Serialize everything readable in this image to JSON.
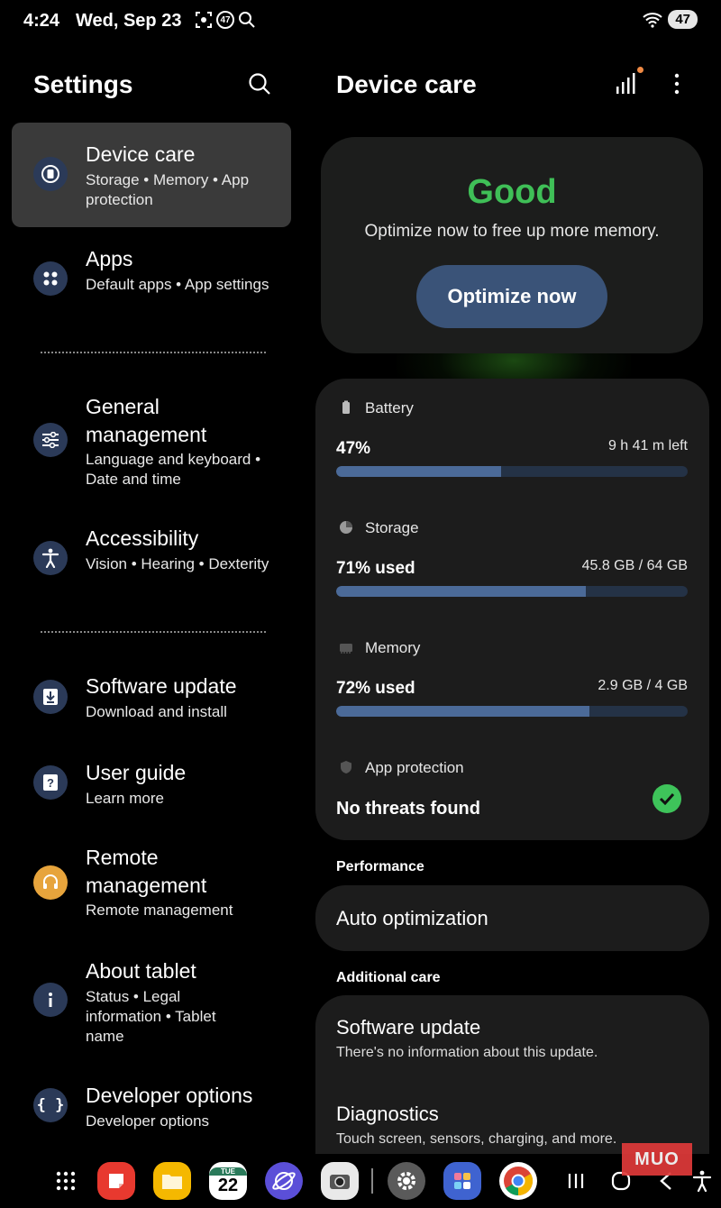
{
  "status_bar": {
    "time": "4:24",
    "date": "Wed, Sep 23",
    "notification_badge": "47",
    "battery": "47"
  },
  "left_panel": {
    "title": "Settings",
    "items": [
      {
        "title": "Device care",
        "subtitle": "Storage • Memory • App protection",
        "icon": "device-care-icon"
      },
      {
        "title": "Apps",
        "subtitle": "Default apps • App settings",
        "icon": "apps-icon"
      },
      {
        "title": "General management",
        "subtitle": "Language and keyboard • Date and time",
        "icon": "sliders-icon"
      },
      {
        "title": "Accessibility",
        "subtitle": "Vision • Hearing • Dexterity",
        "icon": "accessibility-icon"
      },
      {
        "title": "Software update",
        "subtitle": "Download and install",
        "icon": "download-icon"
      },
      {
        "title": "User guide",
        "subtitle": "Learn more",
        "icon": "help-icon"
      },
      {
        "title": "Remote management",
        "subtitle": "Remote management",
        "icon": "headset-icon"
      },
      {
        "title": "About tablet",
        "subtitle": "Status • Legal information • Tablet name",
        "icon": "info-icon"
      },
      {
        "title": "Developer options",
        "subtitle": "Developer options",
        "icon": "braces-icon"
      }
    ]
  },
  "right_panel": {
    "title": "Device care",
    "status": {
      "label": "Good",
      "description": "Optimize now to free up more memory.",
      "button": "Optimize now",
      "color": "#3fbf57"
    },
    "battery": {
      "label": "Battery",
      "value": "47%",
      "detail": "9 h 41 m left",
      "level": 0.47
    },
    "storage": {
      "label": "Storage",
      "value": "71% used",
      "detail": "45.8 GB / 64 GB",
      "level": 0.71
    },
    "memory": {
      "label": "Memory",
      "value": "72% used",
      "detail": "2.9 GB / 4 GB",
      "level": 0.72
    },
    "app_protection": {
      "label": "App protection",
      "value": "No threats found"
    },
    "performance": {
      "header": "Performance",
      "item": "Auto optimization"
    },
    "additional_care": {
      "header": "Additional care",
      "items": [
        {
          "title": "Software update",
          "subtitle": "There's no information about this update."
        },
        {
          "title": "Diagnostics",
          "subtitle": "Touch screen, sensors, charging, and more."
        }
      ]
    }
  },
  "taskbar": {
    "calendar_day": "22",
    "calendar_dow": "TUE",
    "apps": [
      "apps-grid-icon",
      "notes-app-icon",
      "files-app-icon",
      "calendar-app-icon",
      "internet-app-icon",
      "camera-app-icon",
      "settings-app-icon",
      "gallery-app-icon",
      "chrome-app-icon"
    ]
  },
  "watermark": "MUO"
}
